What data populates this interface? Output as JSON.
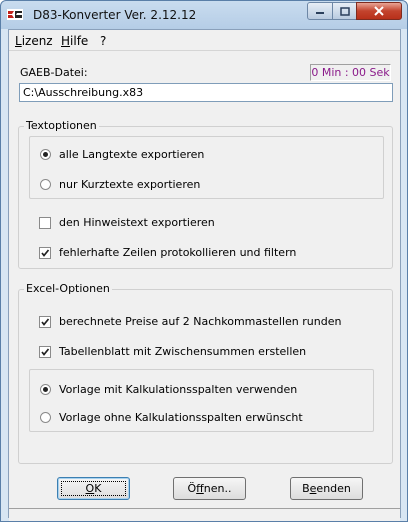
{
  "window": {
    "title": "D83-Konverter Ver. 2.12.12"
  },
  "menu": {
    "items": [
      {
        "label_underlined": "L",
        "label_rest": "izenz"
      },
      {
        "label_underlined": "H",
        "label_rest": "ilfe"
      },
      {
        "label": "?"
      }
    ]
  },
  "gaeb": {
    "label": "GAEB-Datei:",
    "timer": "0 Min : 00 Sek",
    "value": "C:\\Ausschreibung.x83"
  },
  "textoptionen": {
    "title": "Textoptionen",
    "radio_all": {
      "label": "alle Langtexte exportieren",
      "checked": true
    },
    "radio_short": {
      "label": "nur Kurztexte exportieren",
      "checked": false
    },
    "check_hint": {
      "label": "den Hinweistext exportieren",
      "checked": false
    },
    "check_log": {
      "label": "fehlerhafte Zeilen protokollieren und filtern",
      "checked": true
    }
  },
  "excel": {
    "title": "Excel-Optionen",
    "check_round": {
      "label": "berechnete Preise auf 2 Nachkommastellen runden",
      "checked": true
    },
    "check_subtotal": {
      "label": "Tabellenblatt mit Zwischensummen erstellen",
      "checked": true
    },
    "radio_with": {
      "label": "Vorlage mit Kalkulationsspalten verwenden",
      "checked": true
    },
    "radio_without": {
      "label": "Vorlage ohne Kalkulationsspalten erwünscht",
      "checked": false
    }
  },
  "buttons": {
    "ok": {
      "underlined": "O",
      "rest": "K"
    },
    "open": {
      "prefix": "Ö",
      "underlined": "f",
      "rest": "fnen.."
    },
    "quit": {
      "prefix": "B",
      "underlined": "e",
      "rest": "enden"
    }
  }
}
